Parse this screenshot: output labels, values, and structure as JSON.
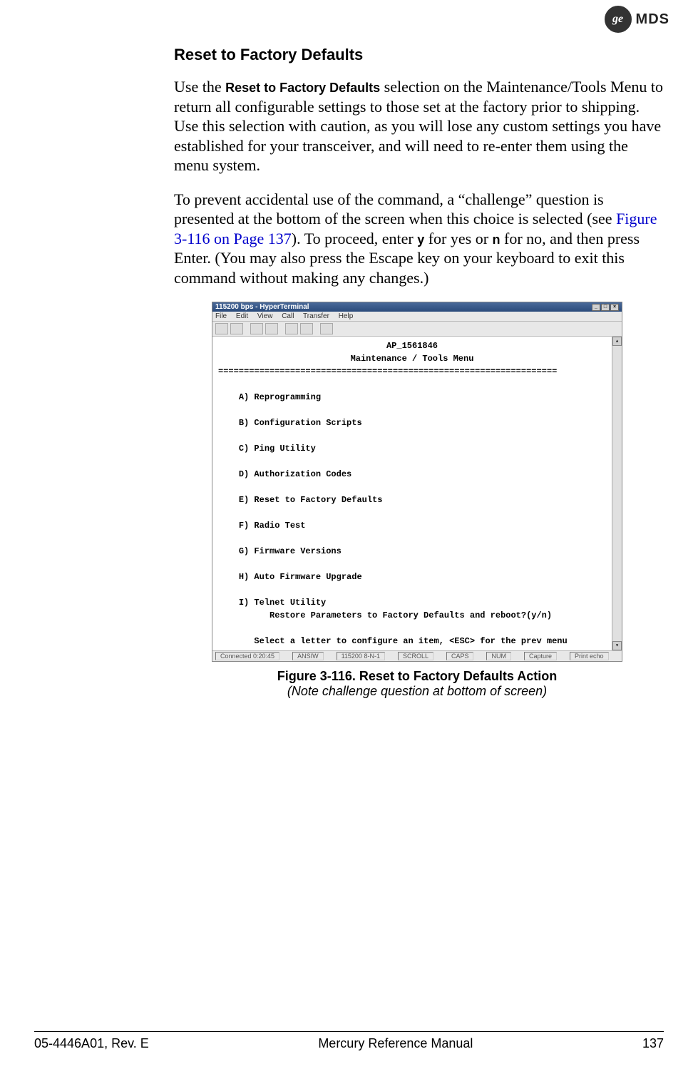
{
  "logo": {
    "ge": "ge",
    "mds": "MDS"
  },
  "heading": "Reset to Factory Defaults",
  "para1": {
    "t1": "Use the ",
    "bold": "Reset to Factory Defaults",
    "t2": " selection on the Maintenance/Tools Menu to return all configurable settings to those set at the factory prior to shipping. Use this selection with caution, as you will lose any custom settings you have established for your transceiver, and will need to re-enter them using the menu system."
  },
  "para2": {
    "t1": "To prevent accidental use of the command, a “challenge” question is presented at the bottom of the screen when this choice is selected (see ",
    "link": "Figure 3-116 on Page 137",
    "t2": "). To proceed, enter ",
    "k1": "y",
    "t3": " for yes or ",
    "k2": "n",
    "t4": " for no, and then press Enter. (You may also press the Escape key on your keyboard to exit this command without making any changes.)"
  },
  "terminal": {
    "title": "115200 bps - HyperTerminal",
    "menus": {
      "file": "File",
      "edit": "Edit",
      "view": "View",
      "call": "Call",
      "transfer": "Transfer",
      "help": "Help"
    },
    "header1": "AP_1561846",
    "header2": "Maintenance / Tools Menu",
    "dashes": "==================================================================",
    "items": {
      "a": "A) Reprogramming",
      "b": "B) Configuration Scripts",
      "c": "C) Ping Utility",
      "d": "D) Authorization Codes",
      "e": "E) Reset to Factory Defaults",
      "f": "F) Radio Test",
      "g": "G) Firmware Versions",
      "h": "H) Auto Firmware Upgrade",
      "i": "I) Telnet Utility"
    },
    "prompt": "Restore Parameters to Factory Defaults and reboot?(y/n)",
    "footer_line": "Select a letter to configure an item, <ESC> for the prev menu",
    "status": {
      "conn": "Connected 0:20:45",
      "ansi": "ANSIW",
      "baud": "115200 8-N-1",
      "s1": "SCROLL",
      "s2": "CAPS",
      "s3": "NUM",
      "s4": "Capture",
      "s5": "Print echo"
    }
  },
  "figure": {
    "title": "Figure 3-116. Reset to Factory Defaults Action",
    "note": "(Note challenge question at bottom of screen)"
  },
  "footer": {
    "left": "05-4446A01, Rev. E",
    "center": "Mercury Reference Manual",
    "right": "137"
  }
}
